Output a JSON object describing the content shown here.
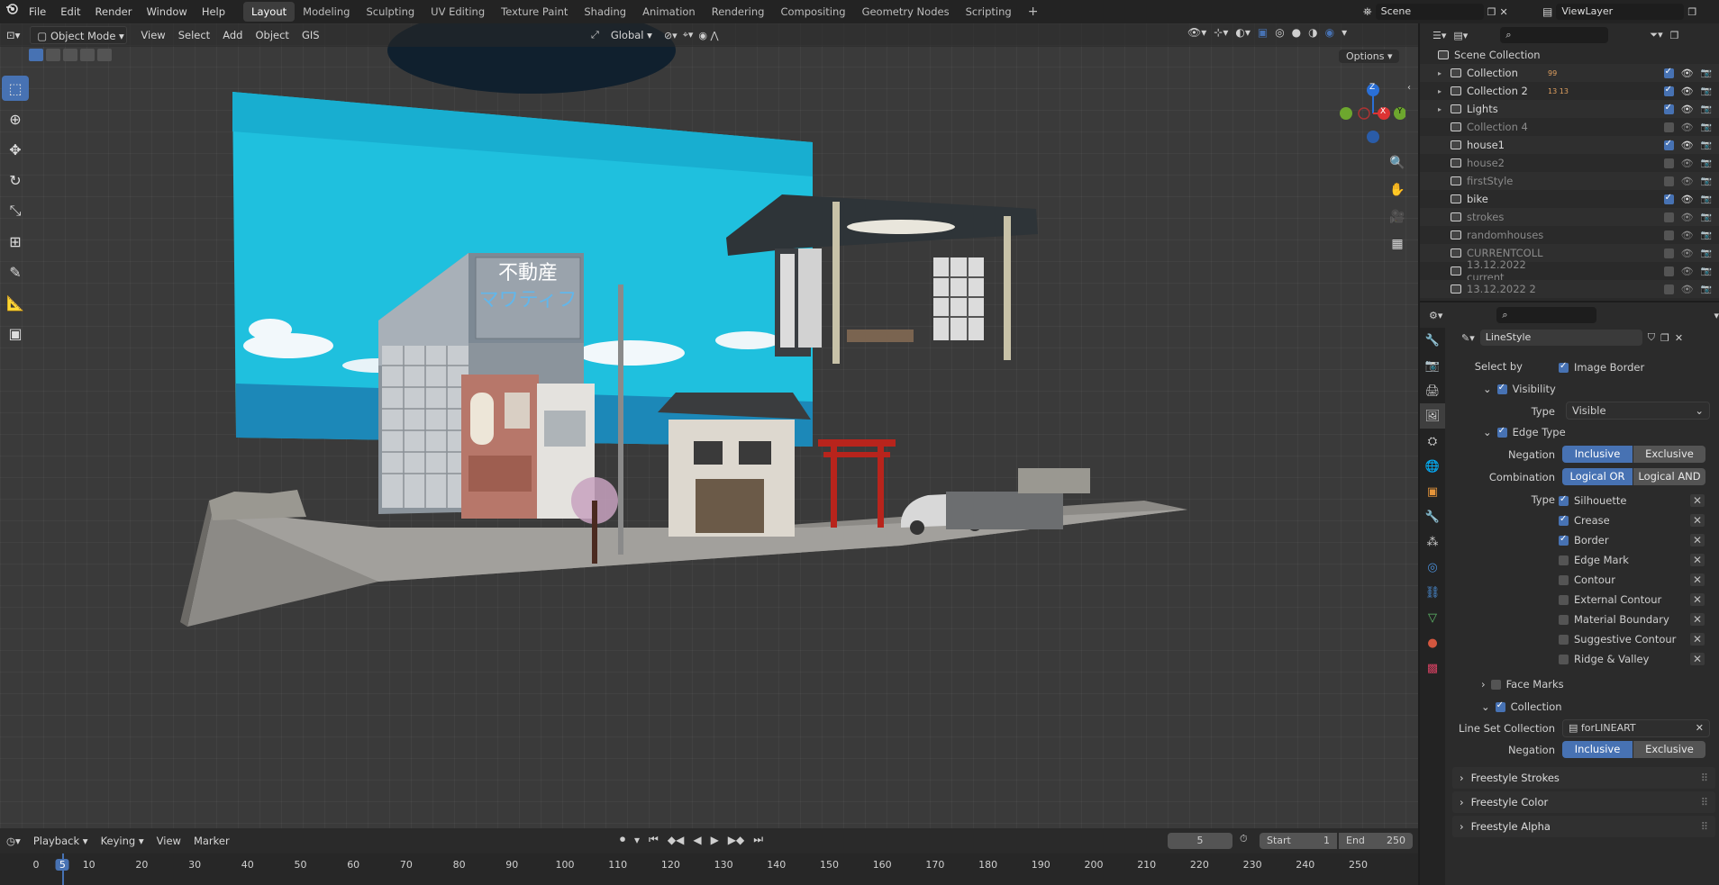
{
  "menu": {
    "items": [
      "File",
      "Edit",
      "Render",
      "Window",
      "Help"
    ],
    "workspaces": [
      "Layout",
      "Modeling",
      "Sculpting",
      "UV Editing",
      "Texture Paint",
      "Shading",
      "Animation",
      "Rendering",
      "Compositing",
      "Geometry Nodes",
      "Scripting"
    ],
    "add_tab": "+",
    "scene": "Scene",
    "view_layer": "ViewLayer"
  },
  "viewport_header": {
    "mode": "Object Mode",
    "menus": [
      "View",
      "Select",
      "Add",
      "Object",
      "GIS"
    ],
    "orientation": "Global",
    "options_label": "Options"
  },
  "gizmo": {
    "z": "Z",
    "x": "X",
    "y": "Y"
  },
  "outliner": {
    "root": "Scene Collection",
    "rows": [
      {
        "name": "Collection",
        "expanded": true,
        "enabled": true,
        "badges": "99"
      },
      {
        "name": "Collection 2",
        "expanded": true,
        "enabled": true,
        "badges": "13 13"
      },
      {
        "name": "Lights",
        "expanded": true,
        "enabled": true,
        "badges": ""
      },
      {
        "name": "Collection 4",
        "expanded": false,
        "enabled": false,
        "badges": ""
      },
      {
        "name": "house1",
        "expanded": false,
        "enabled": true,
        "badges": ""
      },
      {
        "name": "house2",
        "expanded": false,
        "enabled": false,
        "badges": ""
      },
      {
        "name": "firstStyle",
        "expanded": false,
        "enabled": false,
        "badges": ""
      },
      {
        "name": "bike",
        "expanded": false,
        "enabled": true,
        "badges": ""
      },
      {
        "name": "strokes",
        "expanded": false,
        "enabled": false,
        "badges": ""
      },
      {
        "name": "randomhouses",
        "expanded": false,
        "enabled": false,
        "badges": ""
      },
      {
        "name": "CURRENTCOLL",
        "expanded": false,
        "enabled": false,
        "badges": ""
      },
      {
        "name": "13.12.2022 current",
        "expanded": false,
        "enabled": false,
        "badges": ""
      },
      {
        "name": "13.12.2022 2",
        "expanded": false,
        "enabled": false,
        "badges": ""
      }
    ]
  },
  "properties": {
    "linestyle": "LineStyle",
    "select_by_label": "Select by",
    "image_border": "Image Border",
    "visibility": "Visibility",
    "type_label": "Type",
    "type_value": "Visible",
    "edge_type": "Edge Type",
    "negation_label": "Negation",
    "inclusive": "Inclusive",
    "exclusive": "Exclusive",
    "combination_label": "Combination",
    "logical_or": "Logical OR",
    "logical_and": "Logical AND",
    "edge_types": [
      {
        "name": "Silhouette",
        "checked": true
      },
      {
        "name": "Crease",
        "checked": true
      },
      {
        "name": "Border",
        "checked": true
      },
      {
        "name": "Edge Mark",
        "checked": false
      },
      {
        "name": "Contour",
        "checked": false
      },
      {
        "name": "External Contour",
        "checked": false
      },
      {
        "name": "Material Boundary",
        "checked": false
      },
      {
        "name": "Suggestive Contour",
        "checked": false
      },
      {
        "name": "Ridge & Valley",
        "checked": false
      }
    ],
    "face_marks": "Face Marks",
    "collection": "Collection",
    "lineset_collection_label": "Line Set Collection",
    "lineset_collection_value": "forLINEART",
    "panels": [
      "Freestyle Strokes",
      "Freestyle Color",
      "Freestyle Alpha"
    ]
  },
  "timeline": {
    "menus": [
      "Playback",
      "Keying",
      "View",
      "Marker"
    ],
    "current_frame": "5",
    "start_label": "Start",
    "start_value": "1",
    "end_label": "End",
    "end_value": "250",
    "ticks": [
      "0",
      "5",
      "10",
      "20",
      "30",
      "40",
      "50",
      "60",
      "70",
      "80",
      "90",
      "100",
      "110",
      "120",
      "130",
      "140",
      "150",
      "160",
      "170",
      "180",
      "190",
      "200",
      "210",
      "220",
      "230",
      "240",
      "250"
    ]
  },
  "scene_text": {
    "sign_top": "不動産",
    "sign_bottom": "マワティフ"
  },
  "colors": {
    "accent": "#4772b3",
    "sky": "#19c8e0",
    "torii": "#b8241c"
  }
}
